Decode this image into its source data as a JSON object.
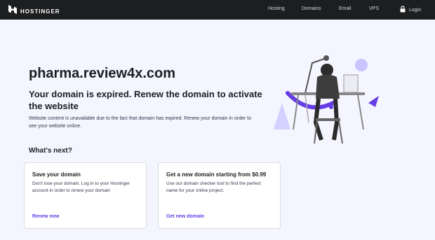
{
  "header": {
    "logo_text": "HOSTINGER",
    "nav": [
      "Hosting",
      "Domains",
      "Email",
      "VPS"
    ],
    "login_label": "Login"
  },
  "main": {
    "domain": "pharma.review4x.com",
    "headline": "Your domain is expired. Renew the domain to activate the website",
    "description": "Website content is unavailable due to the fact that domain has expired. Renew your domain in order to see your website online.",
    "next_heading": "What's next?"
  },
  "cards": [
    {
      "title": "Save your domain",
      "text": "Don't lose your domain. Log in to your Hostinger account in order to renew your domain",
      "link": "Renew now"
    },
    {
      "title": "Get a new domain starting from $0.99",
      "text": "Use our domain checker tool to find the perfect name for your online project.",
      "link": "Get new domain"
    }
  ],
  "colors": {
    "brand": "#673de6",
    "dark": "#1d1e20",
    "background": "#f4f5ff",
    "accent_light": "#8c85ff"
  },
  "icons": [
    "hostinger-logo-icon",
    "lock-icon"
  ]
}
